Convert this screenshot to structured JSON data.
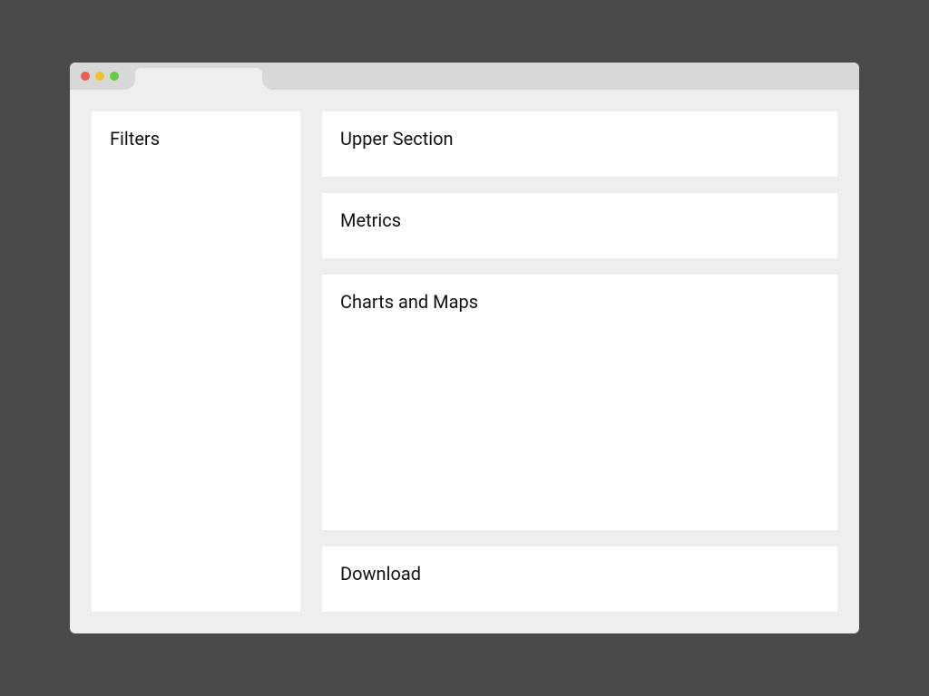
{
  "sidebar": {
    "title": "Filters"
  },
  "main": {
    "upper": {
      "title": "Upper Section"
    },
    "metrics": {
      "title": "Metrics"
    },
    "charts": {
      "title": "Charts and Maps"
    },
    "download": {
      "title": "Download"
    }
  }
}
